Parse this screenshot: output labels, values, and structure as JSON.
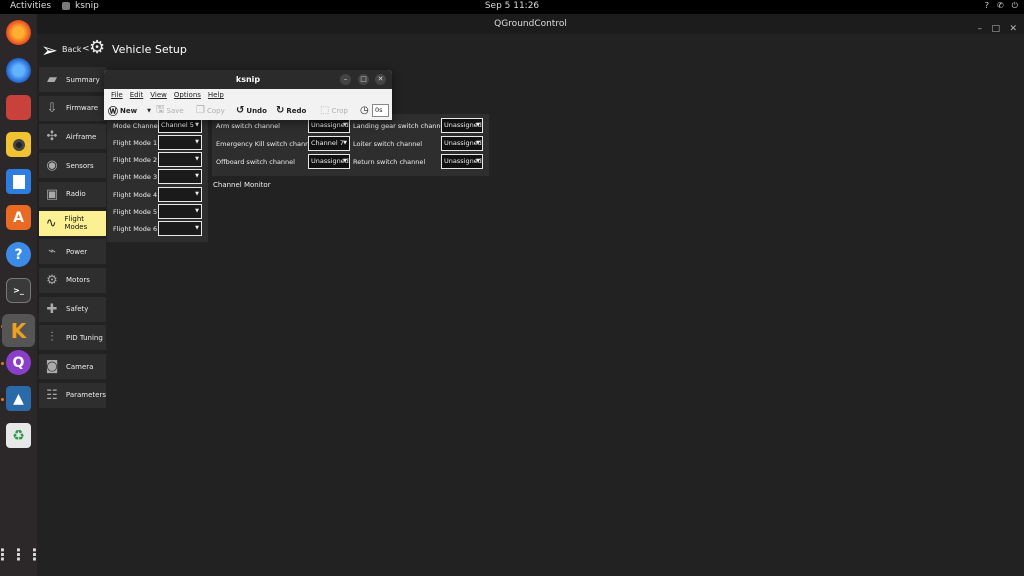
{
  "topbar": {
    "activities": "Activities",
    "app_name": "ksnip",
    "clock": "Sep 5  11:26",
    "tray": [
      "?",
      "✆",
      "⏻"
    ]
  },
  "dock": {
    "items": [
      "firefox-icon",
      "thunderbird-icon",
      "files-icon",
      "rhythmbox-icon",
      "writer-icon",
      "app-center-icon",
      "help-icon",
      "terminal-icon",
      "ksnip-icon",
      "qgroundcontrol-icon",
      "other-app-icon",
      "trash-icon",
      "app-grid-icon"
    ]
  },
  "qgc": {
    "window_title": "QGroundControl",
    "back": "Back",
    "sep": "<",
    "page_title": "Vehicle Setup",
    "menu": [
      {
        "label": "Summary",
        "icon": "summary-icon",
        "active": false
      },
      {
        "label": "Firmware",
        "icon": "firmware-icon",
        "active": false
      },
      {
        "label": "Airframe",
        "icon": "airframe-icon",
        "active": false
      },
      {
        "label": "Sensors",
        "icon": "sensors-icon",
        "active": false
      },
      {
        "label": "Radio",
        "icon": "radio-icon",
        "active": false
      },
      {
        "label": "Flight Modes",
        "icon": "flight-modes-icon",
        "active": true
      },
      {
        "label": "Power",
        "icon": "power-icon",
        "active": false
      },
      {
        "label": "Motors",
        "icon": "motors-icon",
        "active": false
      },
      {
        "label": "Safety",
        "icon": "safety-icon",
        "active": false
      },
      {
        "label": "PID Tuning",
        "icon": "pid-tuning-icon",
        "active": false
      },
      {
        "label": "Camera",
        "icon": "camera-icon",
        "active": false
      },
      {
        "label": "Parameters",
        "icon": "parameters-icon",
        "active": false
      }
    ],
    "modes": {
      "mode_channel_label": "Mode Channel",
      "mode_channel_value": "Channel 5",
      "flight_modes": [
        {
          "label": "Flight Mode 1",
          "value": ""
        },
        {
          "label": "Flight Mode 2",
          "value": ""
        },
        {
          "label": "Flight Mode 3",
          "value": ""
        },
        {
          "label": "Flight Mode 4",
          "value": ""
        },
        {
          "label": "Flight Mode 5",
          "value": ""
        },
        {
          "label": "Flight Mode 6",
          "value": ""
        }
      ]
    },
    "switches": {
      "left": [
        {
          "label": "Arm switch channel",
          "value": "Unassigned"
        },
        {
          "label": "Emergency Kill switch channel",
          "value": "Channel 7"
        },
        {
          "label": "Offboard switch channel",
          "value": "Unassigned"
        }
      ],
      "right": [
        {
          "label": "Landing gear switch channel",
          "value": "Unassigned"
        },
        {
          "label": "Loiter switch channel",
          "value": "Unassigned"
        },
        {
          "label": "Return switch channel",
          "value": "Unassigned"
        }
      ]
    },
    "channel_monitor": "Channel Monitor"
  },
  "ksnip": {
    "title": "ksnip",
    "menu": [
      "File",
      "Edit",
      "View",
      "Options",
      "Help"
    ],
    "tools": {
      "new": "New",
      "save": "Save",
      "copy": "Copy",
      "undo": "Undo",
      "redo": "Redo",
      "crop": "Crop",
      "delay": "0s"
    }
  }
}
